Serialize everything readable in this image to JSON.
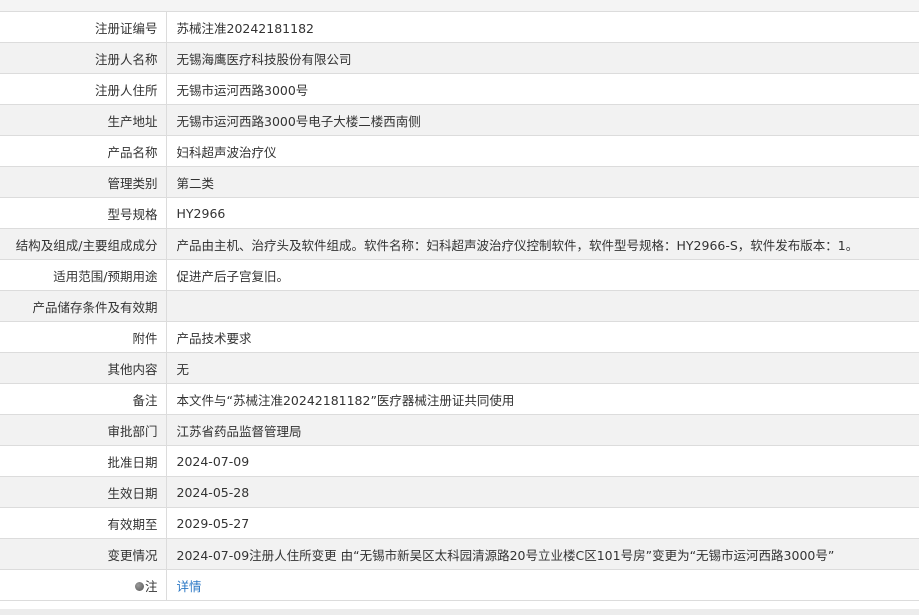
{
  "rows": [
    {
      "label": "注册证编号",
      "value": "苏械注准20242181182"
    },
    {
      "label": "注册人名称",
      "value": "无锡海鹰医疗科技股份有限公司"
    },
    {
      "label": "注册人住所",
      "value": "无锡市运河西路3000号"
    },
    {
      "label": "生产地址",
      "value": "无锡市运河西路3000号电子大楼二楼西南侧"
    },
    {
      "label": "产品名称",
      "value": "妇科超声波治疗仪"
    },
    {
      "label": "管理类别",
      "value": "第二类"
    },
    {
      "label": "型号规格",
      "value": "HY2966"
    },
    {
      "label": "结构及组成/主要组成成分",
      "value": "产品由主机、治疗头及软件组成。软件名称：妇科超声波治疗仪控制软件，软件型号规格：HY2966-S，软件发布版本：1。"
    },
    {
      "label": "适用范围/预期用途",
      "value": "促进产后子宫复旧。"
    },
    {
      "label": "产品储存条件及有效期",
      "value": ""
    },
    {
      "label": "附件",
      "value": "产品技术要求"
    },
    {
      "label": "其他内容",
      "value": "无"
    },
    {
      "label": "备注",
      "value": "本文件与“苏械注准20242181182”医疗器械注册证共同使用"
    },
    {
      "label": "审批部门",
      "value": "江苏省药品监督管理局"
    },
    {
      "label": "批准日期",
      "value": "2024-07-09"
    },
    {
      "label": "生效日期",
      "value": "2024-05-28"
    },
    {
      "label": "有效期至",
      "value": "2029-05-27"
    },
    {
      "label": "变更情况",
      "value": "2024-07-09注册人住所变更 由“无锡市新吴区太科园清源路20号立业楼C区101号房”变更为“无锡市运河西路3000号”"
    }
  ],
  "note": {
    "label": "注",
    "icon": "note-icon",
    "link_text": "详情"
  },
  "colors": {
    "row_alt": "#f2f2f2",
    "border": "#dcdcdc",
    "link": "#2b78c5"
  }
}
